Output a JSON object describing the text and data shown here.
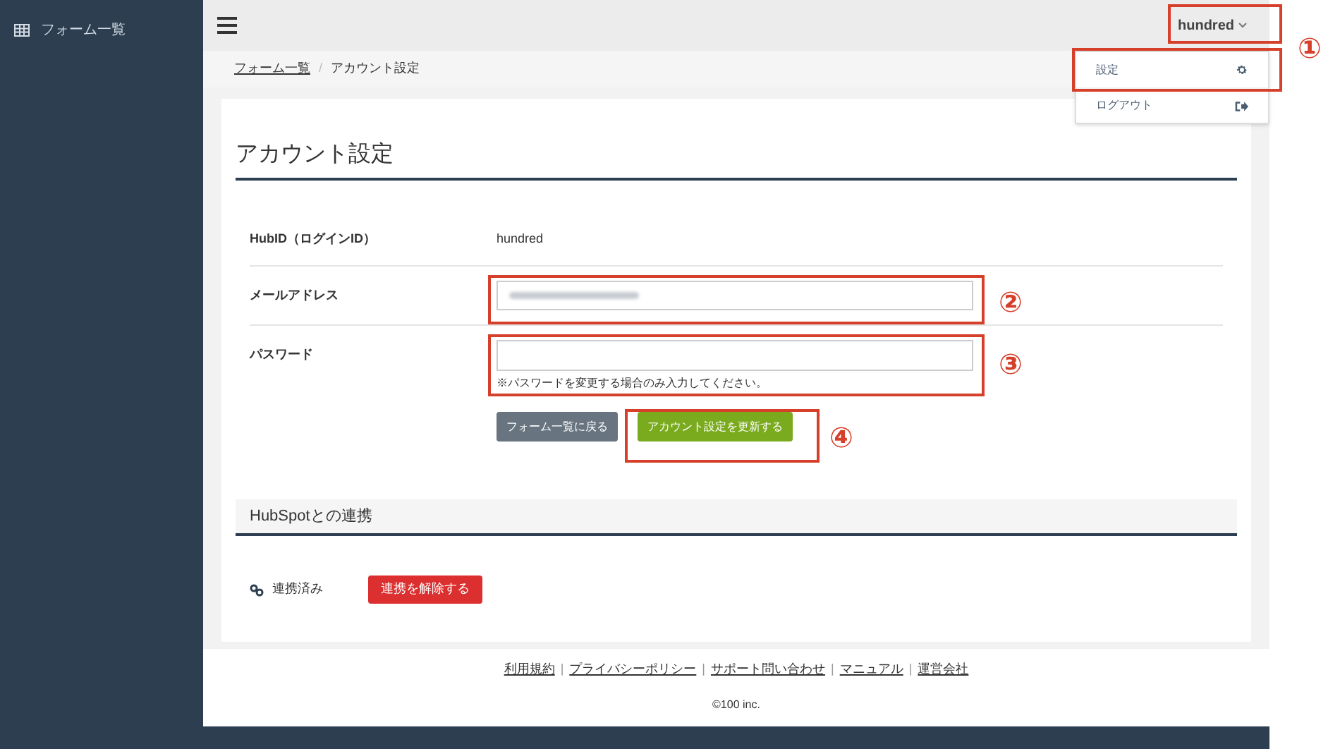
{
  "sidebar": {
    "items": [
      {
        "label": "フォーム一覧",
        "selected": false
      }
    ]
  },
  "header": {
    "user": "hundred"
  },
  "user_menu": {
    "items": [
      {
        "label": "設定",
        "kind": "settings"
      },
      {
        "label": "ログアウト",
        "kind": "logout"
      }
    ]
  },
  "breadcrumb": [
    {
      "label": "フォーム一覧",
      "kind": "link"
    },
    {
      "label": "アカウント設定",
      "kind": "current"
    }
  ],
  "breadcrumb_separator": "/",
  "account": {
    "title": "アカウント設定",
    "fields": [
      {
        "label": "HubID（ログインID）",
        "kind": "text",
        "value": "hundred"
      },
      {
        "label": "メールアドレス",
        "kind": "blurred-input"
      },
      {
        "label": "パスワード",
        "kind": "input",
        "help": "※パスワードを変更する場合のみ入力してください。"
      }
    ],
    "buttons": [
      {
        "label": "フォーム一覧に戻る",
        "kind": "secondary"
      },
      {
        "label": "アカウント設定を更新する",
        "kind": "primary"
      }
    ]
  },
  "hubspot": {
    "title": "HubSpotとの連携",
    "status": "連携済み",
    "button": "連携を解除する"
  },
  "footer": {
    "links": [
      "利用規約",
      "プライバシーポリシー",
      "サポート問い合わせ",
      "マニュアル",
      "運営会社"
    ],
    "separator": "|",
    "copyright": "©100 inc."
  },
  "annotations": [
    {
      "number": "①"
    },
    {
      "number": "②"
    },
    {
      "number": "③"
    },
    {
      "number": "④"
    }
  ]
}
